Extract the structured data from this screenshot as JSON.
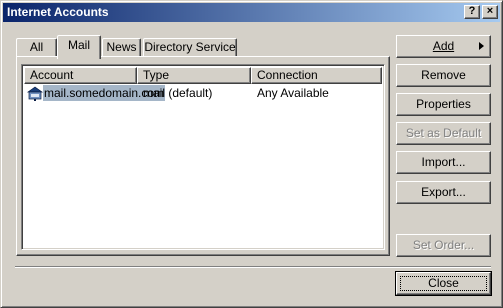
{
  "window": {
    "title": "Internet Accounts",
    "help_label": "?",
    "close_label": "×",
    "titlebar_colors": [
      "#0a246a",
      "#a6caf0"
    ]
  },
  "tabs": [
    {
      "label": "All",
      "active": false
    },
    {
      "label": "Mail",
      "active": true
    },
    {
      "label": "News",
      "active": false
    },
    {
      "label": "Directory Service",
      "active": false
    }
  ],
  "list": {
    "columns": [
      "Account",
      "Type",
      "Connection"
    ],
    "rows": [
      {
        "account": "mail.somedomain.com",
        "type": "mail (default)",
        "connection": "Any Available",
        "icon": "mail-account-icon",
        "selected": true
      }
    ]
  },
  "buttons": {
    "add": "Add",
    "remove": "Remove",
    "properties": "Properties",
    "set_default": "Set as Default",
    "import": "Import...",
    "export": "Export...",
    "set_order": "Set Order...",
    "close": "Close"
  }
}
